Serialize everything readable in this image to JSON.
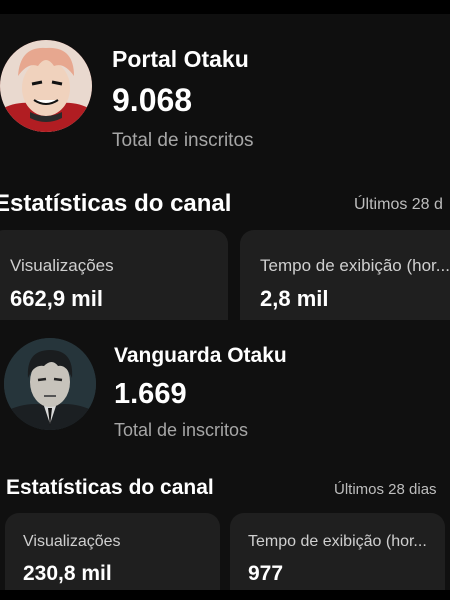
{
  "channels": [
    {
      "name": "Portal Otaku",
      "subscriber_count": "9.068",
      "subscriber_label": "Total de inscritos",
      "stats_title": "Estatísticas do canal",
      "stats_range": "Últimos 28 d",
      "cards": [
        {
          "label": "Visualizações",
          "value": "662,9 mil"
        },
        {
          "label": "Tempo de exibição (hor...",
          "value": "2,8 mil"
        }
      ]
    },
    {
      "name": "Vanguarda Otaku",
      "subscriber_count": "1.669",
      "subscriber_label": "Total de inscritos",
      "stats_title": "Estatísticas do canal",
      "stats_range": "Últimos 28 dias",
      "cards": [
        {
          "label": "Visualizações",
          "value": "230,8 mil"
        },
        {
          "label": "Tempo de exibição (hor...",
          "value": "977"
        }
      ]
    }
  ]
}
